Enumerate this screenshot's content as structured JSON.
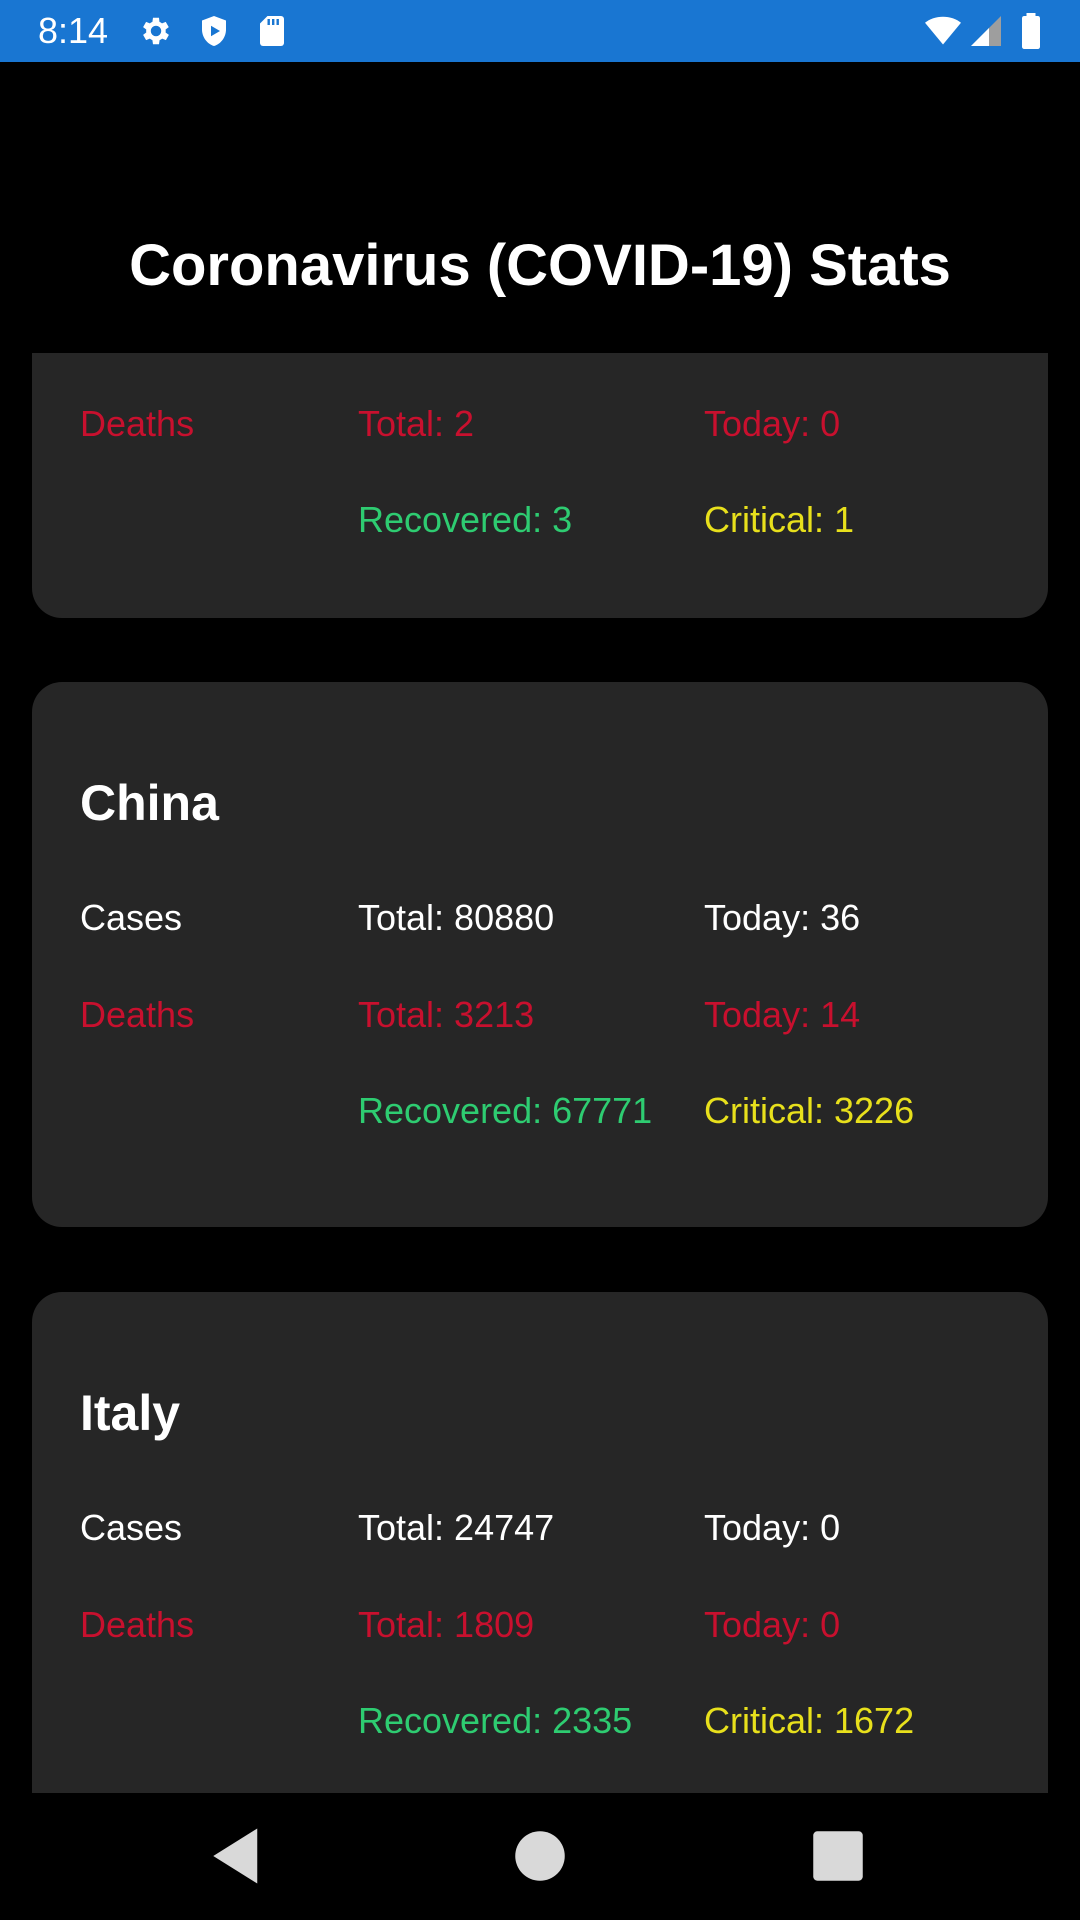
{
  "status_bar": {
    "time": "8:14",
    "icons_left": [
      "settings-icon",
      "shield-icon",
      "sd-card-icon"
    ],
    "icons_right": [
      "wifi-icon",
      "signal-icon",
      "battery-icon"
    ],
    "color": "#1976d2"
  },
  "app": {
    "title": "Coronavirus (COVID-19) Stats"
  },
  "cards": [
    {
      "country": "",
      "cases_label": "",
      "cases_total": "",
      "cases_today": "",
      "deaths_label": "Deaths",
      "deaths_total": "Total: 2",
      "deaths_today": "Today: 0",
      "recovered": "Recovered: 3",
      "critical": "Critical: 1"
    },
    {
      "country": "China",
      "cases_label": "Cases",
      "cases_total": "Total: 80880",
      "cases_today": "Today: 36",
      "deaths_label": "Deaths",
      "deaths_total": "Total: 3213",
      "deaths_today": "Today: 14",
      "recovered": "Recovered: 67771",
      "critical": "Critical: 3226"
    },
    {
      "country": "Italy",
      "cases_label": "Cases",
      "cases_total": "Total: 24747",
      "cases_today": "Today: 0",
      "deaths_label": "Deaths",
      "deaths_total": "Total: 1809",
      "deaths_today": "Today: 0",
      "recovered": "Recovered: 2335",
      "critical": "Critical: 1672"
    }
  ],
  "colors": {
    "cases": "#ffffff",
    "deaths": "#c8102e",
    "recovered": "#2ecc71",
    "critical": "#e8e01c",
    "card_bg": "#262626"
  },
  "nav_bar": {
    "buttons": [
      "back-icon",
      "home-icon",
      "recents-icon"
    ]
  }
}
